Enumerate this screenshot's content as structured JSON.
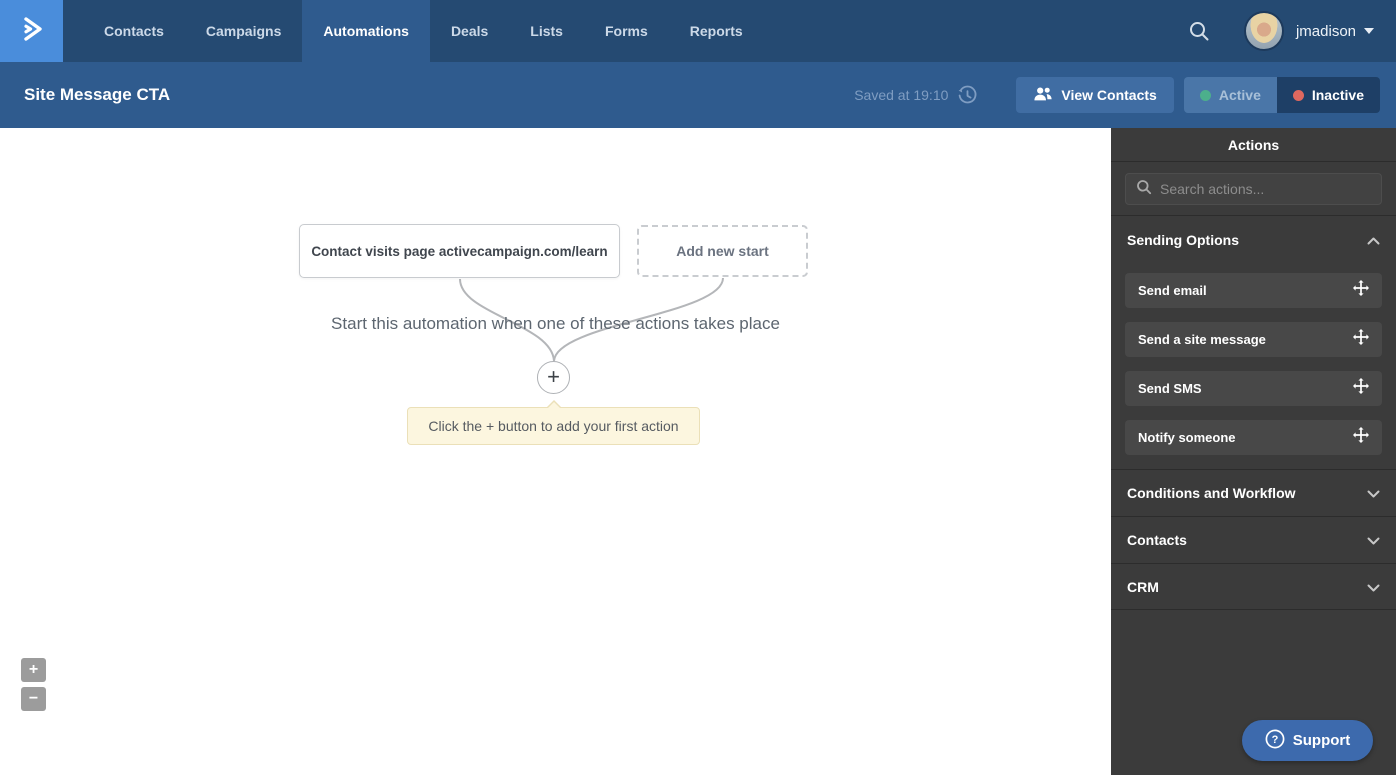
{
  "nav": {
    "tabs": [
      "Contacts",
      "Campaigns",
      "Automations",
      "Deals",
      "Lists",
      "Forms",
      "Reports"
    ],
    "active_tab": "Automations",
    "username": "jmadison"
  },
  "header": {
    "title": "Site Message CTA",
    "saved_text": "Saved at 19:10",
    "view_contacts_label": "View Contacts",
    "active_label": "Active",
    "inactive_label": "Inactive",
    "status": "Inactive"
  },
  "canvas": {
    "heading": "Start this automation when one of these actions takes place",
    "trigger_label": "Contact visits page activecampaign.com/learn",
    "add_new_start_label": "Add new start",
    "plus_label": "+",
    "tooltip": "Click the + button to add your first action",
    "zoom_in_label": "+",
    "zoom_out_label": "−"
  },
  "sidebar": {
    "title": "Actions",
    "search_placeholder": "Search actions...",
    "sections": [
      {
        "label": "Sending Options",
        "expanded": true,
        "items": [
          "Send email",
          "Send a site message",
          "Send SMS",
          "Notify someone"
        ]
      },
      {
        "label": "Conditions and Workflow",
        "expanded": false
      },
      {
        "label": "Contacts",
        "expanded": false
      },
      {
        "label": "CRM",
        "expanded": false
      }
    ],
    "support_label": "Support"
  },
  "icons": {
    "logo": "activecampaign-double-chevron",
    "nav_search": "search-icon",
    "user_caret": "chevron-down-icon",
    "saved": "history-clock-icon",
    "view_contacts": "people-icon",
    "sidebar_search": "search-icon",
    "expanded_section": "chevron-up-icon",
    "collapsed_section": "chevron-down-icon",
    "action_item": "move-arrows-icon",
    "support": "question-circle-icon"
  },
  "colors": {
    "nav_navy": "#254a72",
    "logo_blue": "#4a8ddb",
    "header_blue": "#2f5b8e",
    "button_blue": "#406da3",
    "active_dot": "#4caf8c",
    "inactive_dot": "#df685f",
    "sidebar_dark": "#3b3b3b",
    "card_dark": "#484848",
    "tooltip_cream": "#fcf6df",
    "support_blue": "#3d6aad"
  }
}
